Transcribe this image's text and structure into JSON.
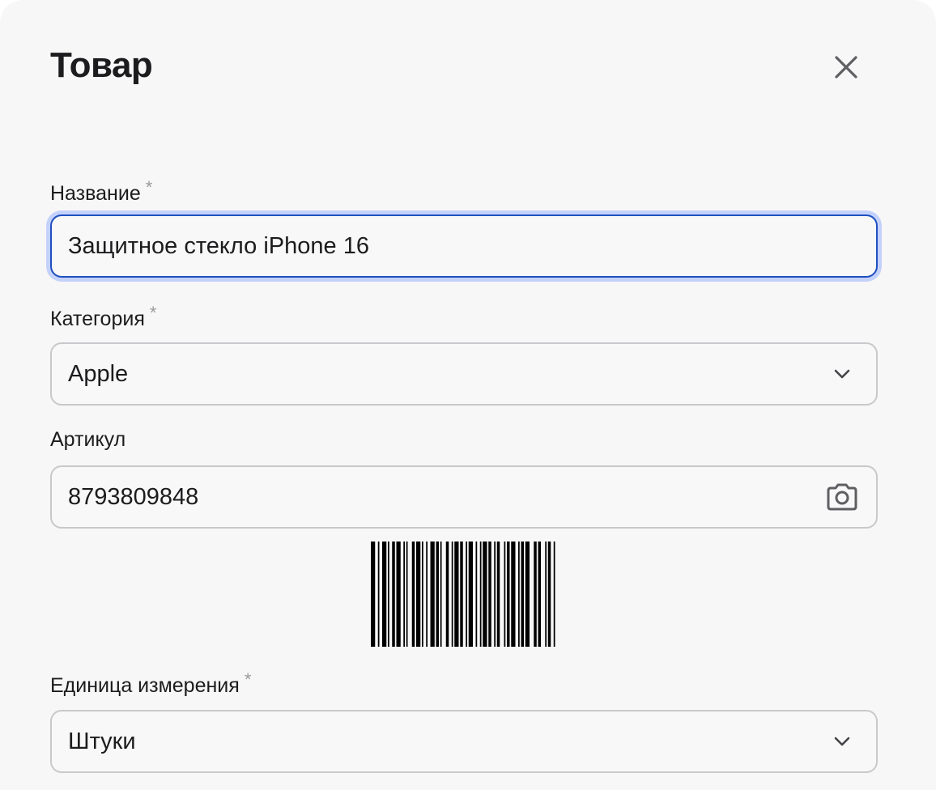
{
  "dialog": {
    "title": "Товар",
    "close_icon": "close-icon"
  },
  "fields": {
    "name": {
      "label": "Название",
      "required_mark": "*",
      "value": "Защитное стекло iPhone 16"
    },
    "category": {
      "label": "Категория",
      "required_mark": "*",
      "value": "Apple",
      "icon": "chevron-down-icon"
    },
    "sku": {
      "label": "Артикул",
      "value": "8793809848",
      "icon": "camera-icon"
    },
    "unit": {
      "label": "Единица измерения",
      "required_mark": "*",
      "value": "Штуки",
      "icon": "chevron-down-icon"
    }
  },
  "barcode": {
    "icon": "barcode-image"
  },
  "colors": {
    "background": "#f7f7f7",
    "focus_border": "#1f4fc0",
    "focus_ring": "#c4d2fb",
    "field_border": "#c9c9cc",
    "required_mark": "#9a9a9e"
  }
}
